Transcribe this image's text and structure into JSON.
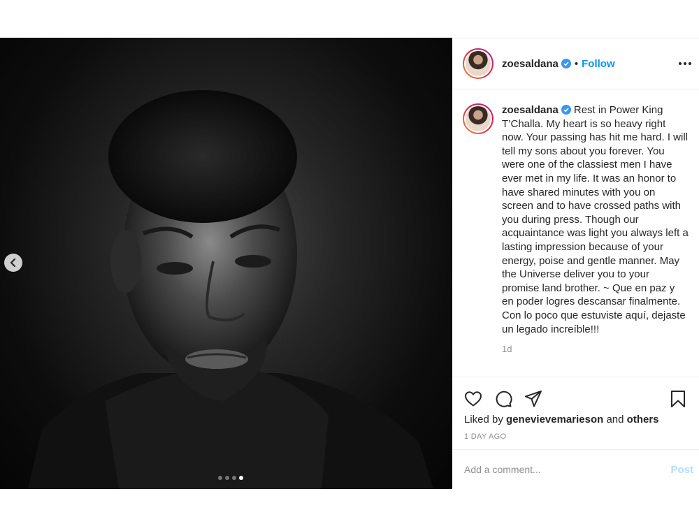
{
  "post": {
    "username": "zoesaldana",
    "follow_label": "Follow",
    "separator": "•",
    "caption": "Rest in Power King T’Challa. My heart is so heavy right now. Your passing has hit me hard. I will tell my sons about you forever. You were one of the classiest men I have ever met in my life. It was an honor to have shared minutes with you on screen and to have crossed paths with you during press. Though our acquaintance was light you always left a lasting impression because of your energy, poise and gentle manner. May the Universe deliver you to your promise land brother. ~ Que en paz y en poder logres descansar finalmente. Con lo poco que estuviste aquí, dejaste un legado increíble!!!",
    "caption_age": "1d",
    "liked_by_prefix": "Liked by",
    "liked_by_user": "genevievemarieson",
    "liked_by_and": "and",
    "liked_by_others": "others",
    "posted_ago": "1 DAY AGO",
    "comment_placeholder": "Add a comment...",
    "post_label": "Post"
  },
  "carousel": {
    "total": 4,
    "active_index": 3
  },
  "icons": {
    "verified": "verified-badge-icon",
    "more": "more-options-icon",
    "prev": "chevron-left-icon",
    "like": "heart-icon",
    "comment": "comment-bubble-icon",
    "share": "paper-plane-icon",
    "save": "bookmark-icon"
  },
  "colors": {
    "accent": "#0095f6",
    "post_disabled": "#b2dffc",
    "muted": "#8e8e8e",
    "text": "#262626"
  }
}
